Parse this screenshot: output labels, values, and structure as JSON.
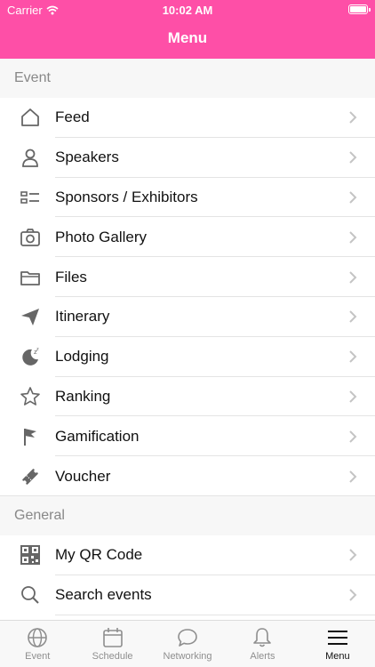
{
  "status_bar": {
    "carrier": "Carrier",
    "time": "10:02 AM"
  },
  "header": {
    "title": "Menu"
  },
  "sections": {
    "event": {
      "title": "Event",
      "items": [
        {
          "label": "Feed",
          "icon": "home-icon"
        },
        {
          "label": "Speakers",
          "icon": "person-icon"
        },
        {
          "label": "Sponsors / Exhibitors",
          "icon": "list-icon"
        },
        {
          "label": "Photo Gallery",
          "icon": "camera-icon"
        },
        {
          "label": "Files",
          "icon": "folder-icon"
        },
        {
          "label": "Itinerary",
          "icon": "paper-plane-icon"
        },
        {
          "label": "Lodging",
          "icon": "moon-sleep-icon"
        },
        {
          "label": "Ranking",
          "icon": "star-icon"
        },
        {
          "label": "Gamification",
          "icon": "flag-icon"
        },
        {
          "label": "Voucher",
          "icon": "ticket-icon"
        }
      ]
    },
    "general": {
      "title": "General",
      "items": [
        {
          "label": "My QR Code",
          "icon": "qr-code-icon"
        },
        {
          "label": "Search events",
          "icon": "search-icon"
        }
      ]
    }
  },
  "tabbar": {
    "active": "Menu",
    "tabs": [
      {
        "label": "Event",
        "icon": "globe-icon"
      },
      {
        "label": "Schedule",
        "icon": "calendar-icon"
      },
      {
        "label": "Networking",
        "icon": "chat-bubble-icon"
      },
      {
        "label": "Alerts",
        "icon": "bell-icon"
      },
      {
        "label": "Menu",
        "icon": "hamburger-menu-icon"
      }
    ]
  },
  "colors": {
    "header_bg": "#fe4fa7",
    "icon_gray": "#666666",
    "section_text": "#888888"
  }
}
